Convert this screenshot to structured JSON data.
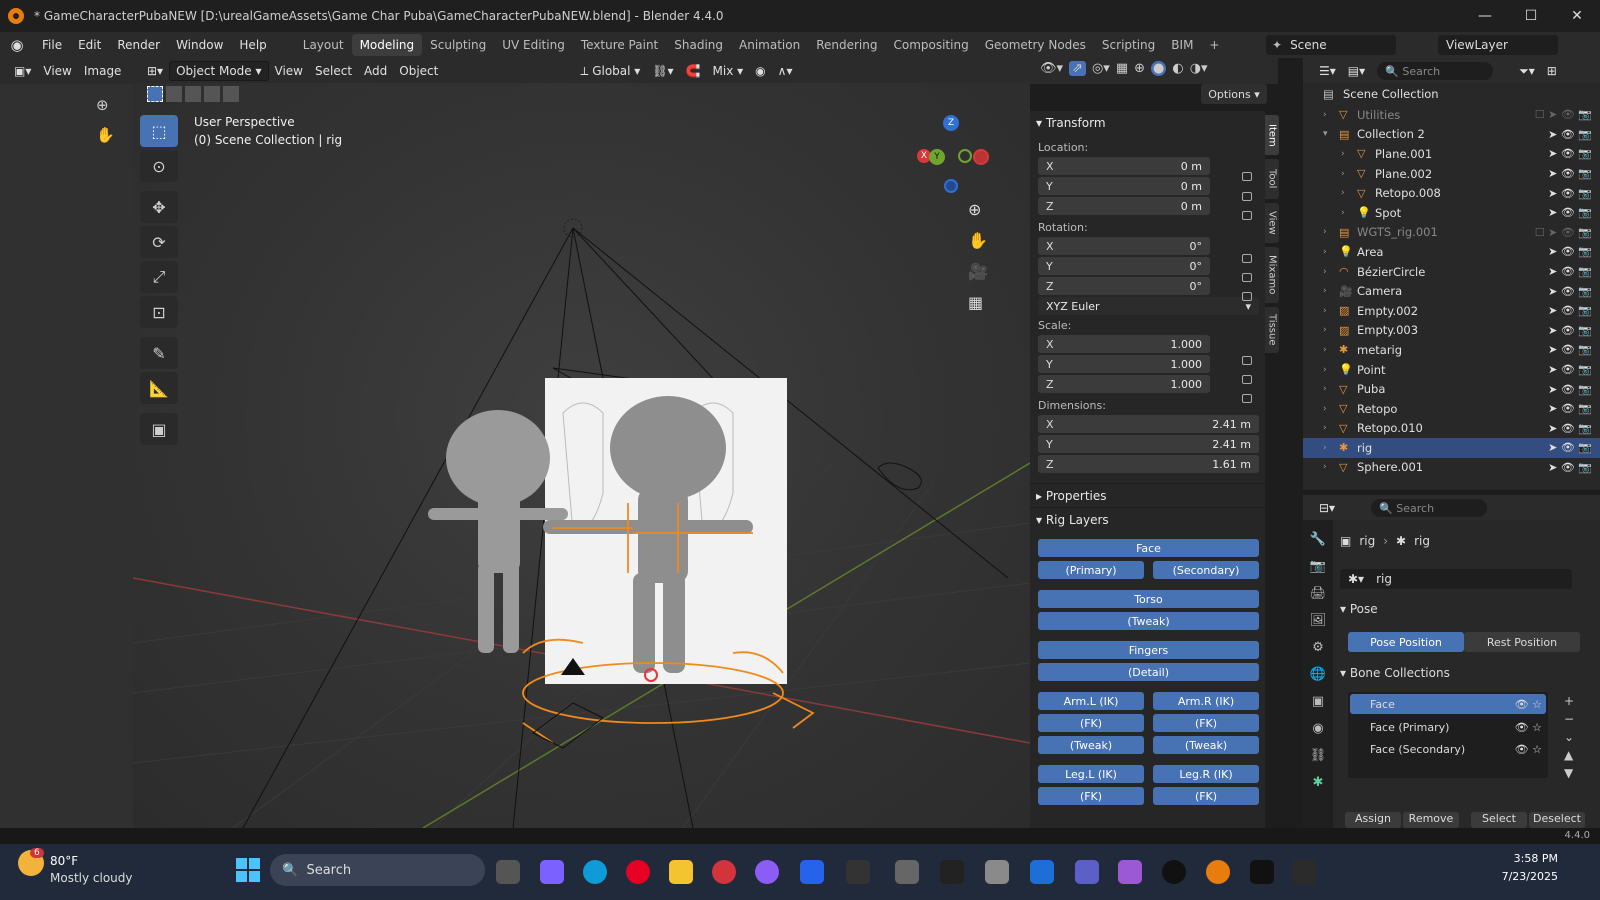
{
  "titlebar": {
    "title": "* GameCharacterPubaNEW [D:\\urealGameAssets\\Game Char Puba\\GameCharacterPubaNEW.blend] - Blender 4.4.0"
  },
  "menu": [
    "File",
    "Edit",
    "Render",
    "Window",
    "Help"
  ],
  "workspaces": [
    "Layout",
    "Modeling",
    "Sculpting",
    "UV Editing",
    "Texture Paint",
    "Shading",
    "Animation",
    "Rendering",
    "Compositing",
    "Geometry Nodes",
    "Scripting",
    "BIM"
  ],
  "active_workspace": "Modeling",
  "scene": {
    "name": "Scene",
    "view_layer": "ViewLayer"
  },
  "left_editor": {
    "view": "View",
    "image": "Image"
  },
  "viewport_header": {
    "mode": "Object Mode",
    "view": "View",
    "select": "Select",
    "add": "Add",
    "object": "Object",
    "orientation": "Global",
    "snap": "Mix",
    "options": "Options"
  },
  "viewport": {
    "perspective": "User Perspective",
    "context": "(0) Scene Collection | rig"
  },
  "transform": {
    "title": "Transform",
    "location_label": "Location:",
    "location": [
      {
        "axis": "X",
        "value": "0 m"
      },
      {
        "axis": "Y",
        "value": "0 m"
      },
      {
        "axis": "Z",
        "value": "0 m"
      }
    ],
    "rotation_label": "Rotation:",
    "rotation": [
      {
        "axis": "X",
        "value": "0°"
      },
      {
        "axis": "Y",
        "value": "0°"
      },
      {
        "axis": "Z",
        "value": "0°"
      }
    ],
    "rotation_mode": "XYZ Euler",
    "scale_label": "Scale:",
    "scale": [
      {
        "axis": "X",
        "value": "1.000"
      },
      {
        "axis": "Y",
        "value": "1.000"
      },
      {
        "axis": "Z",
        "value": "1.000"
      }
    ],
    "dimensions_label": "Dimensions:",
    "dimensions": [
      {
        "axis": "X",
        "value": "2.41 m"
      },
      {
        "axis": "Y",
        "value": "2.41 m"
      },
      {
        "axis": "Z",
        "value": "1.61 m"
      }
    ]
  },
  "properties_title": "Properties",
  "rig_layers": {
    "title": "Rig Layers",
    "face": "Face",
    "primary": "(Primary)",
    "secondary": "(Secondary)",
    "torso": "Torso",
    "tweak": "(Tweak)",
    "fingers": "Fingers",
    "detail": "(Detail)",
    "arm_l": "Arm.L (IK)",
    "arm_r": "Arm.R (IK)",
    "fk": "(FK)",
    "leg_l": "Leg.L (IK)",
    "leg_r": "Leg.R (IK)"
  },
  "npanel_tabs": [
    "Item",
    "Tool",
    "View",
    "Mixamo",
    "Tissue"
  ],
  "outliner": {
    "search_placeholder": "Search",
    "root": "Scene Collection",
    "rows": [
      {
        "name": "Utilities",
        "indent": 1,
        "dim": true
      },
      {
        "name": "Collection 2",
        "indent": 1
      },
      {
        "name": "Plane.001",
        "indent": 2
      },
      {
        "name": "Plane.002",
        "indent": 2
      },
      {
        "name": "Retopo.008",
        "indent": 2
      },
      {
        "name": "Spot",
        "indent": 2
      },
      {
        "name": "WGTS_rig.001",
        "indent": 1,
        "dim": true
      },
      {
        "name": "Area",
        "indent": 1
      },
      {
        "name": "BézierCircle",
        "indent": 1
      },
      {
        "name": "Camera",
        "indent": 1
      },
      {
        "name": "Empty.002",
        "indent": 1
      },
      {
        "name": "Empty.003",
        "indent": 1
      },
      {
        "name": "metarig",
        "indent": 1
      },
      {
        "name": "Point",
        "indent": 1
      },
      {
        "name": "Puba",
        "indent": 1
      },
      {
        "name": "Retopo",
        "indent": 1
      },
      {
        "name": "Retopo.010",
        "indent": 1
      },
      {
        "name": "rig",
        "indent": 1,
        "selected": true
      },
      {
        "name": "Sphere.001",
        "indent": 1
      }
    ]
  },
  "properties": {
    "search_placeholder": "Search",
    "breadcrumb_obj": "rig",
    "breadcrumb_data": "rig",
    "data_name": "rig",
    "pose_title": "Pose",
    "pose_position": "Pose Position",
    "rest_position": "Rest Position",
    "bone_collections_title": "Bone Collections",
    "collections": [
      "Face",
      "Face (Primary)",
      "Face (Secondary)"
    ],
    "assign": "Assign",
    "remove": "Remove",
    "select": "Select",
    "deselect": "Deselect"
  },
  "status": {
    "version": "4.4.0"
  },
  "taskbar": {
    "temp": "80°F",
    "weather": "Mostly cloudy",
    "badge": "6",
    "search": "Search",
    "time": "3:58 PM",
    "date": "7/23/2025"
  },
  "colors": {
    "accent": "#4772b3",
    "orange": "#e87d0d",
    "selected_row": "#334d80"
  }
}
